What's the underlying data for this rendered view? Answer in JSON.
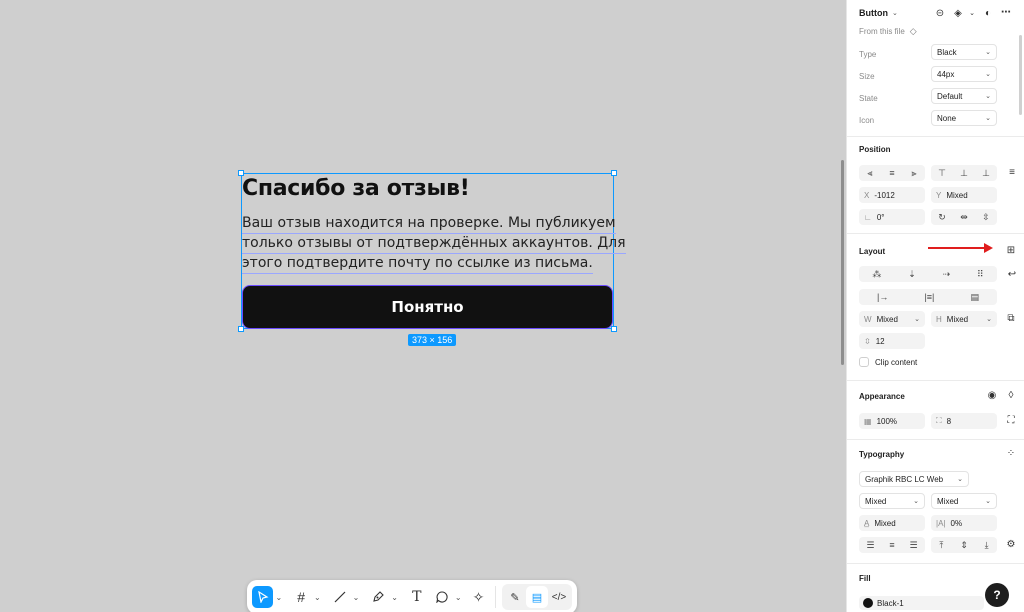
{
  "canvas": {
    "frame": {
      "title": "Спасибо за отзыв!",
      "body_lines": [
        "Ваш отзыв находится на проверке. Мы публикуем",
        "только отзывы от подтверждённых аккаунтов. Для",
        "этого подтвердите почту по ссылке из письма."
      ],
      "button_label": "Понятно",
      "size_badge": "373 × 156"
    }
  },
  "toolbar": {
    "tools": [
      "move-tool",
      "frame-tool",
      "line-tool",
      "pen-tool",
      "text-tool",
      "comment-tool",
      "actions-tool"
    ],
    "modes": [
      "draw-mode",
      "design-mode",
      "dev-mode"
    ]
  },
  "panel": {
    "component": {
      "name": "Button",
      "source": "From this file"
    },
    "properties": [
      {
        "label": "Type",
        "value": "Black"
      },
      {
        "label": "Size",
        "value": "44px"
      },
      {
        "label": "State",
        "value": "Default"
      },
      {
        "label": "Icon",
        "value": "None"
      }
    ],
    "position": {
      "title": "Position",
      "x_label": "X",
      "x_value": "-1012",
      "y_label": "Y",
      "y_value": "Mixed",
      "rotation": "0°"
    },
    "layout": {
      "title": "Layout",
      "w_label": "W",
      "w_value": "Mixed",
      "h_label": "H",
      "h_value": "Mixed",
      "gap": "12",
      "clip_content": "Clip content"
    },
    "appearance": {
      "title": "Appearance",
      "opacity": "100%",
      "radius": "8"
    },
    "typography": {
      "title": "Typography",
      "font": "Graphik RBC LC Web",
      "weight": "Mixed",
      "size": "Mixed",
      "line_height": "Mixed",
      "letter_spacing": "0%"
    },
    "fill": {
      "title": "Fill",
      "style": "Black-1"
    },
    "help": "?"
  }
}
